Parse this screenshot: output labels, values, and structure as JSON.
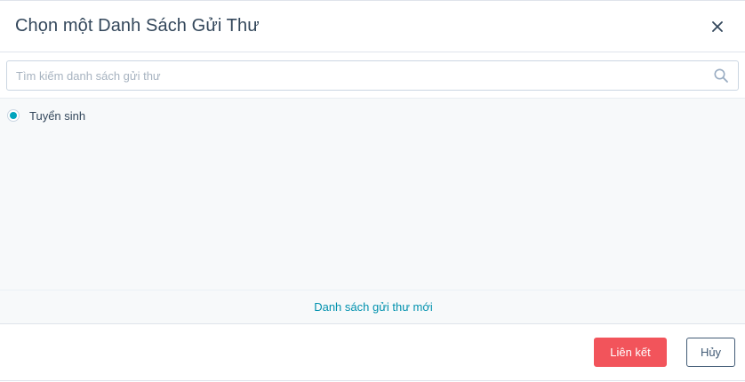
{
  "modal": {
    "title": "Chọn một Danh Sách Gửi Thư",
    "close_icon": "close-icon"
  },
  "search": {
    "placeholder": "Tìm kiếm danh sách gửi thư",
    "value": "",
    "icon": "search-icon"
  },
  "lists": {
    "items": [
      {
        "label": "Tuyển sinh",
        "selected": true
      }
    ]
  },
  "new_list": {
    "label": "Danh sách gửi thư mới"
  },
  "footer": {
    "confirm_label": "Liên kết",
    "cancel_label": "Hủy"
  },
  "colors": {
    "accent": "#00a4bd",
    "primary_button": "#f2545b",
    "link": "#0091ae"
  }
}
